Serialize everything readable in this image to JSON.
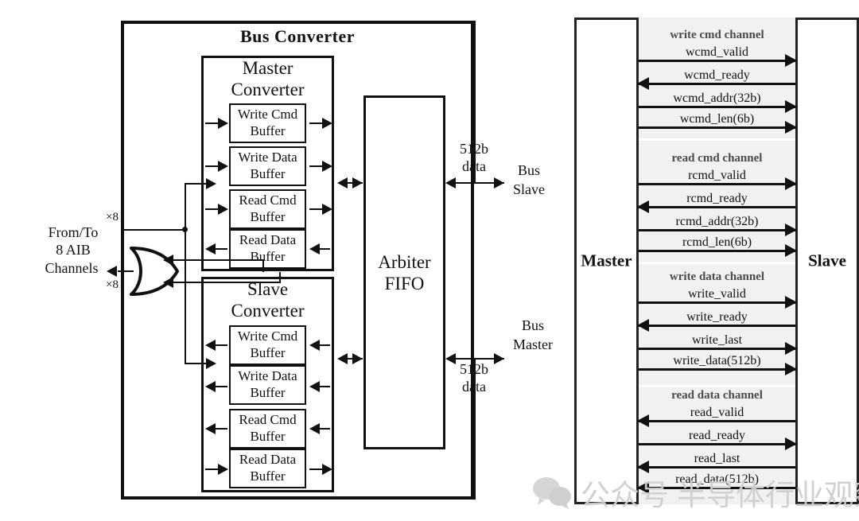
{
  "diagram": {
    "left": {
      "outer_title": "Bus  Converter",
      "master_converter": {
        "title_line1": "Master",
        "title_line2": "Converter",
        "buffers": [
          {
            "line1": "Write Cmd",
            "line2": "Buffer"
          },
          {
            "line1": "Write Data",
            "line2": "Buffer"
          },
          {
            "line1": "Read Cmd",
            "line2": "Buffer"
          },
          {
            "line1": "Read Data",
            "line2": "Buffer"
          }
        ]
      },
      "slave_converter": {
        "title_line1": "Slave",
        "title_line2": "Converter",
        "buffers": [
          {
            "line1": "Write Cmd",
            "line2": "Buffer"
          },
          {
            "line1": "Write Data",
            "line2": "Buffer"
          },
          {
            "line1": "Read Cmd",
            "line2": "Buffer"
          },
          {
            "line1": "Read Data",
            "line2": "Buffer"
          }
        ]
      },
      "arbiter": {
        "line1": "Arbiter",
        "line2": "FIFO"
      },
      "io_left": {
        "line1": "From/To",
        "line2": "8 AIB",
        "line3": "Channels",
        "mult_top": "×8",
        "mult_bottom": "×8"
      },
      "io_right_top": {
        "width_line1": "512b",
        "width_line2": "data",
        "port_line1": "Bus",
        "port_line2": "Slave"
      },
      "io_right_bottom": {
        "width_line1": "512b",
        "width_line2": "data",
        "port_line1": "Bus",
        "port_line2": "Master"
      }
    },
    "right": {
      "master_label": "Master",
      "slave_label": "Slave",
      "channels": [
        {
          "name": "write cmd channel",
          "signals": [
            {
              "label": "wcmd_valid",
              "direction": "right"
            },
            {
              "label": "wcmd_ready",
              "direction": "left"
            },
            {
              "label": "wcmd_addr(32b)",
              "direction": "right"
            },
            {
              "label": "wcmd_len(6b)",
              "direction": "right"
            }
          ]
        },
        {
          "name": "read cmd channel",
          "signals": [
            {
              "label": "rcmd_valid",
              "direction": "right"
            },
            {
              "label": "rcmd_ready",
              "direction": "left"
            },
            {
              "label": "rcmd_addr(32b)",
              "direction": "right"
            },
            {
              "label": "rcmd_len(6b)",
              "direction": "right"
            }
          ]
        },
        {
          "name": "write data channel",
          "signals": [
            {
              "label": "write_valid",
              "direction": "right"
            },
            {
              "label": "write_ready",
              "direction": "left"
            },
            {
              "label": "write_last",
              "direction": "right"
            },
            {
              "label": "write_data(512b)",
              "direction": "right"
            }
          ]
        },
        {
          "name": "read data channel",
          "signals": [
            {
              "label": "read_valid",
              "direction": "left"
            },
            {
              "label": "read_ready",
              "direction": "right"
            },
            {
              "label": "read_last",
              "direction": "left"
            },
            {
              "label": "read_data(512b)",
              "direction": "left"
            }
          ]
        }
      ]
    },
    "watermark": {
      "prefix": "公众号",
      "name": "半导体行业观察"
    },
    "colors": {
      "ink": "#111111",
      "band": "#f1f1f1",
      "channel_head": "#4a4a4a",
      "watermark": "#cfcfcf"
    }
  }
}
